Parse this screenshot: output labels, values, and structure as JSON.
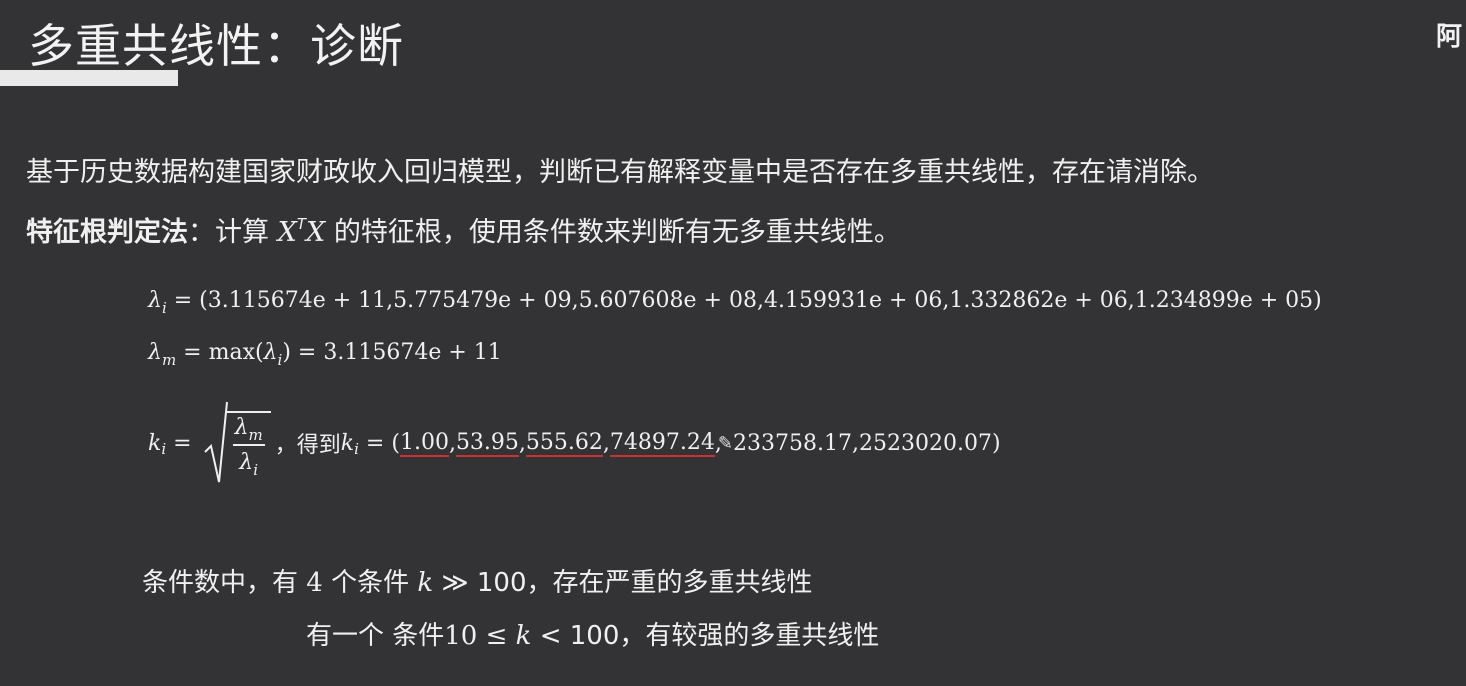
{
  "slide": {
    "title": "多重共线性：诊断",
    "corner_char": "阿",
    "paragraph1": "基于历史数据构建国家财政收入回归模型，判断已有解释变量中是否存在多重共线性，存在请消除。",
    "method_label": "特征根判定法",
    "method_text_pre": "：计算 ",
    "method_text_post": " 的特征根，使用条件数来判断有无多重共线性。",
    "matrix_base": "X",
    "matrix_sup": "T",
    "matrix_tail": "X",
    "eq1_lhs": "λ",
    "eq1_sub": "i",
    "eq1_rhs": " = (3.115674e + 11,5.775479e + 09,5.607608e + 08,4.159931e + 06,1.332862e + 06,1.234899e + 05)",
    "eq2_lhs": "λ",
    "eq2_sub": "m",
    "eq2_mid": " = max(",
    "eq2_inner": "λ",
    "eq2_inner_sub": "i",
    "eq2_rhs": ") = 3.115674e + 11",
    "eq3_lhs": "k",
    "eq3_sub": "i",
    "eq3_eq": " = ",
    "eq3_num": "λ",
    "eq3_num_sub": "m",
    "eq3_den": "λ",
    "eq3_den_sub": "i",
    "eq3_text": "，得到 ",
    "eq3_k": "k",
    "eq3_k_sub": "i",
    "eq3_values_prefix": " = (",
    "eq3_v1": "1.00",
    "eq3_v2": "53.95",
    "eq3_v3": "555.62",
    "eq3_v4": "74897.24",
    "eq3_v5": "233758.17",
    "eq3_v6": "2523020.07",
    "eq3_values_suffix": ")",
    "concl1_a": "条件数中，有 ",
    "concl1_n": "4",
    "concl1_b": " 个条件 ",
    "concl1_k": "k",
    "concl1_c": " ≫ 100，存在严重的多重共线性",
    "concl2_a": "有一个 条件",
    "concl2_b": "10 ≤ ",
    "concl2_k": "k",
    "concl2_c": " < 100，有较强的多重共线性"
  }
}
